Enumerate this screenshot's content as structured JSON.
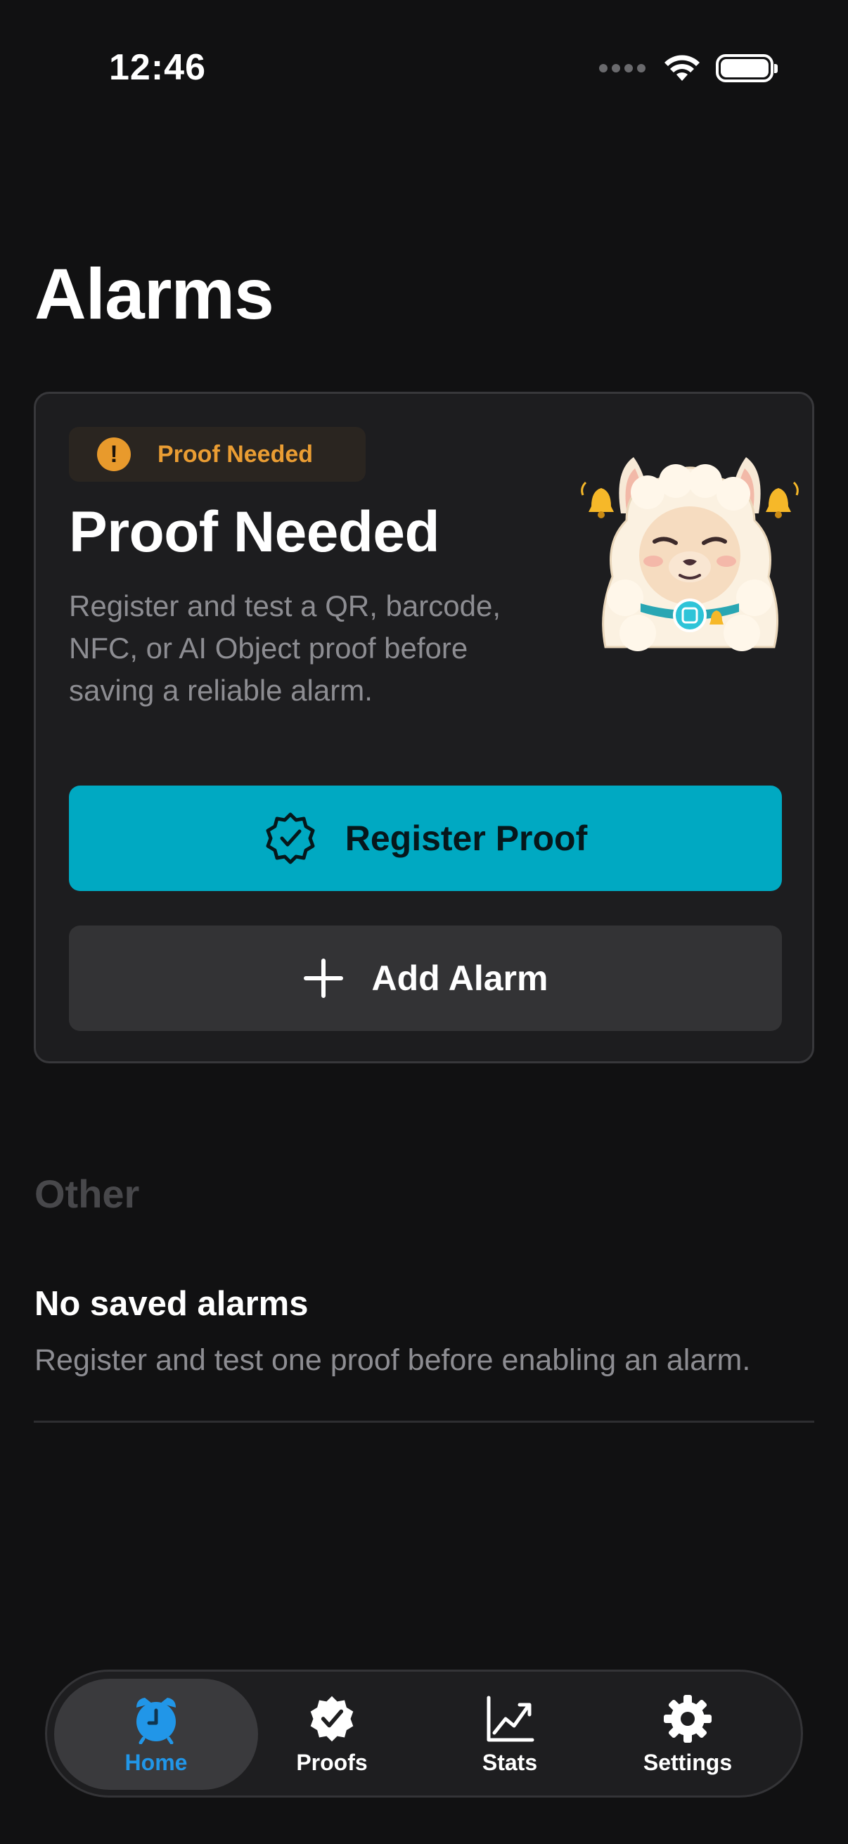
{
  "status_bar": {
    "time": "12:46"
  },
  "page": {
    "title": "Alarms"
  },
  "card": {
    "badge_label": "Proof Needed",
    "title": "Proof Needed",
    "description": "Register and test a QR, barcode, NFC, or AI Object proof before saving a reliable alarm.",
    "primary_button_label": "Register Proof",
    "secondary_button_label": "Add Alarm"
  },
  "other": {
    "section_title": "Other",
    "empty_title": "No saved alarms",
    "empty_description": "Register and test one proof before enabling an alarm."
  },
  "tabbar": {
    "tabs": [
      {
        "label": "Home",
        "icon": "alarm-clock-icon",
        "active": true
      },
      {
        "label": "Proofs",
        "icon": "checkmark-seal-icon",
        "active": false
      },
      {
        "label": "Stats",
        "icon": "chart-line-icon",
        "active": false
      },
      {
        "label": "Settings",
        "icon": "gear-icon",
        "active": false
      }
    ]
  },
  "colors": {
    "accent": "#00a9c2",
    "badge": "#ea9d33",
    "tab_active": "#2196e8",
    "background": "#111112"
  }
}
